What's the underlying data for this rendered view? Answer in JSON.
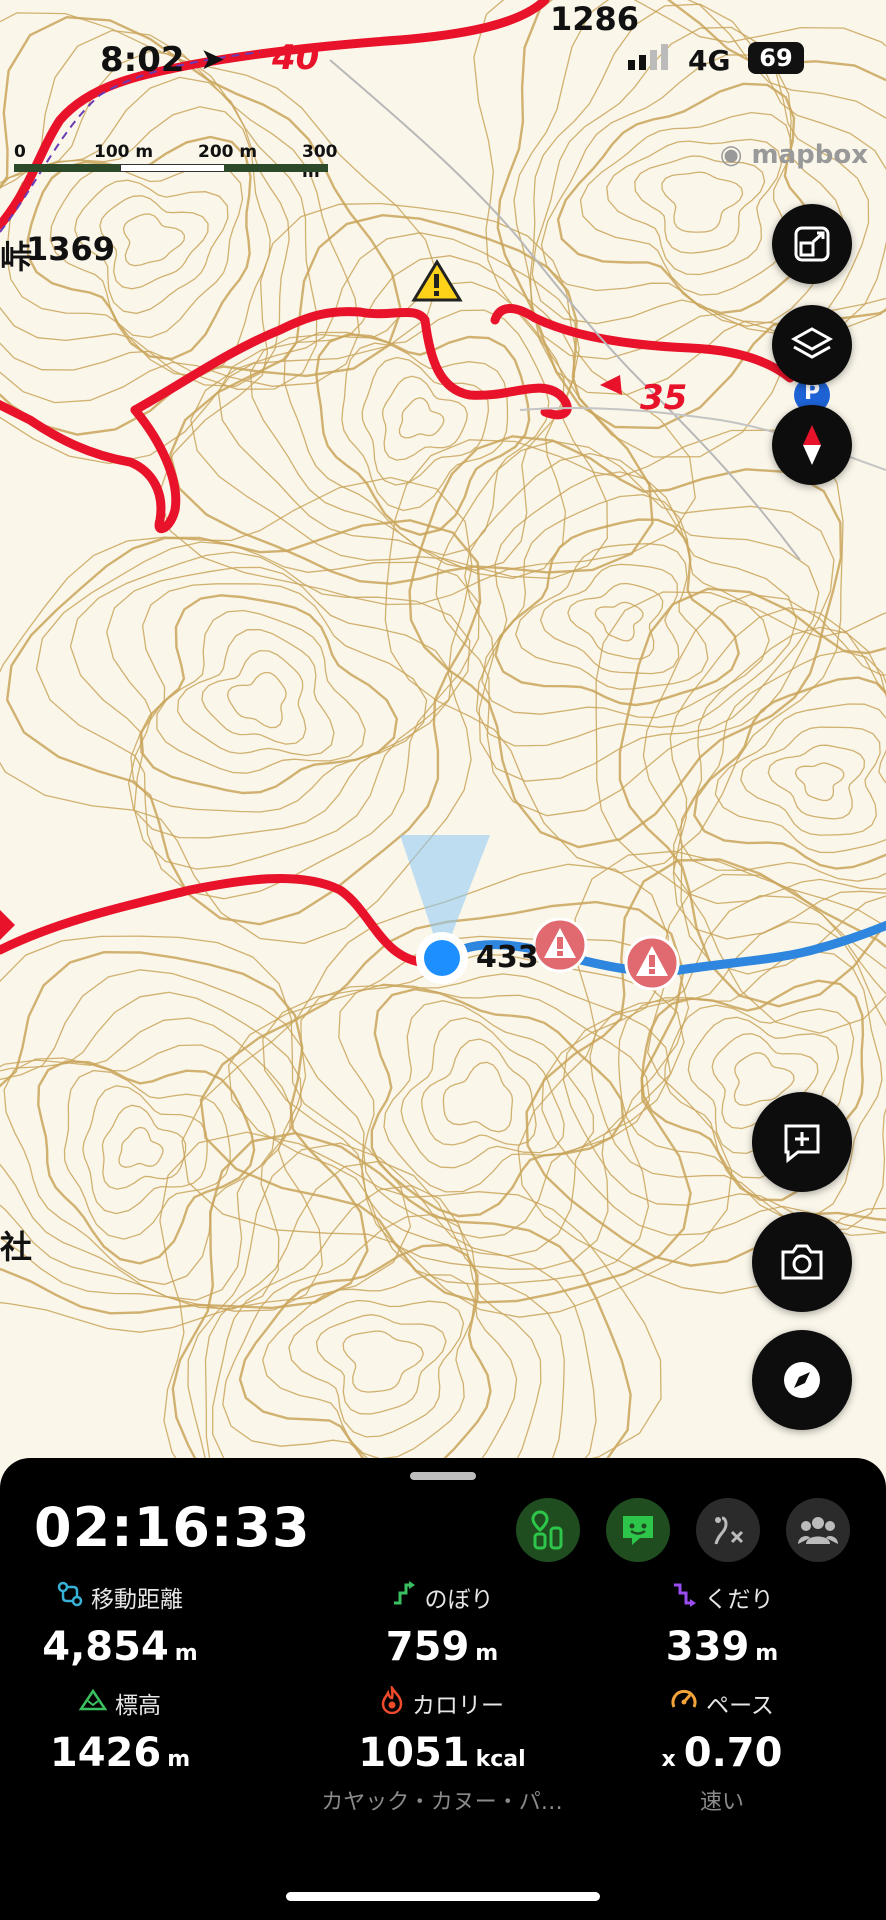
{
  "status_bar": {
    "time": "8:02",
    "network": "4G",
    "battery": "69"
  },
  "map": {
    "scale": {
      "labels": [
        "0",
        "100 m",
        "200 m",
        "300 m"
      ]
    },
    "attribution": "mapbox",
    "labels": {
      "peak_1286": "1286",
      "peak_1369": "1369",
      "pass_char": "峠",
      "shrine_char": "社",
      "elev_433": "433",
      "route_40": "40",
      "route_35": "35",
      "parking": "P"
    },
    "icons": {
      "fullscreen": "expand-icon",
      "layers": "layers-icon",
      "compass": "compass-needle-icon",
      "add_memo": "add-memo-icon",
      "camera": "camera-icon",
      "navigate": "navigate-icon"
    },
    "colors": {
      "red_trail": "#e8132a",
      "blue_track": "#2e86de",
      "contour": "#c9a55a",
      "location": "#1e8fff"
    }
  },
  "activity": {
    "elapsed": "02:16:33",
    "mode_buttons": [
      {
        "name": "checkpoint-icon",
        "color": "#2ec64a"
      },
      {
        "name": "chat-face-icon",
        "color": "#2ec64a"
      },
      {
        "name": "route-off-icon",
        "color": "#bbbbbb"
      },
      {
        "name": "group-icon",
        "color": "#bbbbbb"
      }
    ],
    "stats": [
      {
        "label": "移動距離",
        "value": "4,854",
        "unit": "m",
        "icon": "distance-icon",
        "color": "#37b2d6",
        "prefix": "",
        "sub": ""
      },
      {
        "label": "のぼり",
        "value": "759",
        "unit": "m",
        "icon": "ascent-icon",
        "color": "#3ac060",
        "prefix": "",
        "sub": ""
      },
      {
        "label": "くだり",
        "value": "339",
        "unit": "m",
        "icon": "descent-icon",
        "color": "#9b4cf0",
        "prefix": "",
        "sub": ""
      },
      {
        "label": "標高",
        "value": "1426",
        "unit": "m",
        "icon": "elevation-icon",
        "color": "#3ac060",
        "prefix": "",
        "sub": ""
      },
      {
        "label": "カロリー",
        "value": "1051",
        "unit": "kcal",
        "icon": "calorie-icon",
        "color": "#ef4b2a",
        "prefix": "",
        "sub": "カヤック・カヌー・パ…"
      },
      {
        "label": "ペース",
        "value": "0.70",
        "unit": "",
        "icon": "pace-icon",
        "color": "#f2a33a",
        "prefix": "x",
        "sub": "速い"
      }
    ]
  }
}
